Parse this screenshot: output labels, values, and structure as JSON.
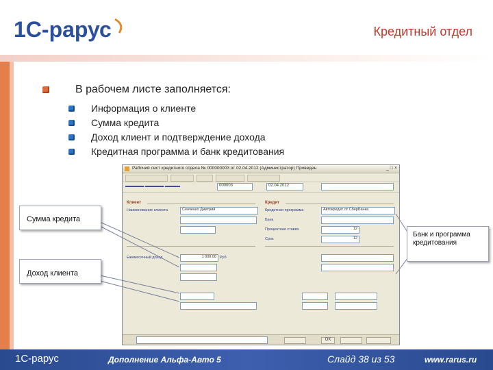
{
  "header": {
    "logo_text": "1С-рарус",
    "title": "Кредитный отдел"
  },
  "content": {
    "main_bullet": "В рабочем листе заполняется:",
    "sub_items": [
      "Информация о клиенте",
      "Сумма кредита",
      "Доход клиент и подтверждение дохода",
      "Кредитная программа и банк кредитования"
    ]
  },
  "window": {
    "title": "Рабочий лист кредитного отдела № 000000003 от 02.04.2012 (Администратор) Проведен",
    "number_value": "000003",
    "date_value": "02.04.2012",
    "section_client": "Клиент",
    "section_credit": "Кредит",
    "label_full_name": "Наименование клиента",
    "value_full_name": "Сенченко Дмитрий",
    "label_program": "Кредитная программа",
    "value_program": "Автокредит от СберБанка",
    "label_bank": "Банк",
    "label_rate": "Процентная ставка",
    "value_rate": "12",
    "label_term": "Срок",
    "value_term": "12",
    "label_income": "Ежемесячный доход",
    "value_income": "1 000,00",
    "currency": "Руб",
    "label_ok": "OK"
  },
  "callouts": {
    "sum": "Сумма кредита",
    "income": "Доход клиента",
    "bank": "Банк и программа кредитования"
  },
  "footer": {
    "logo_text": "1С-рарус",
    "center": "Дополнение Альфа-Авто 5",
    "slide": "Слайд 38 из 53",
    "site": "www.rarus.ru"
  },
  "colors": {
    "accent": "#c0392b",
    "footer_bg": "#2a4a8f",
    "bullet_main": "#e06a3a",
    "bullet_sub": "#2d74c4"
  }
}
